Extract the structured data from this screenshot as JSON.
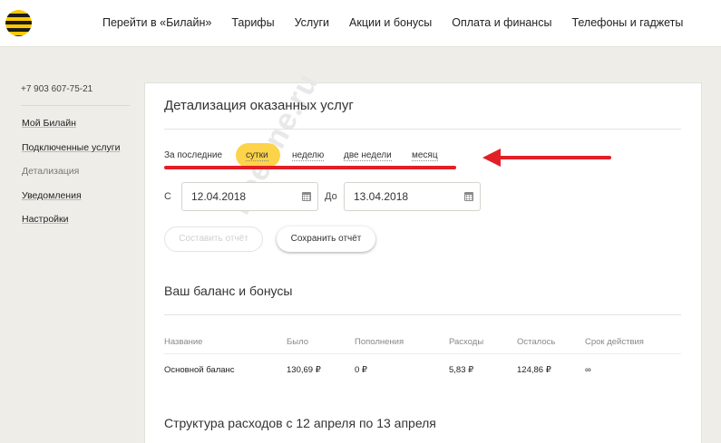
{
  "header": {
    "nav": [
      "Перейти в «Билайн»",
      "Тарифы",
      "Услуги",
      "Акции и бонусы",
      "Оплата и финансы",
      "Телефоны и гаджеты"
    ]
  },
  "sidebar": {
    "phone": "+7 903 607-75-21",
    "items": [
      {
        "label": "Мой Билайн"
      },
      {
        "label": "Подключенные услуги"
      },
      {
        "label": "Детализация"
      },
      {
        "label": "Уведомления"
      },
      {
        "label": "Настройки"
      }
    ]
  },
  "detail": {
    "title": "Детализация оказанных услуг",
    "period_label": "За последние",
    "period_options": [
      "сутки",
      "неделю",
      "две недели",
      "месяц"
    ],
    "selected_period": "сутки",
    "from_label": "С",
    "from_date": "12.04.2018",
    "to_label": "До",
    "to_date": "13.04.2018",
    "build_report": "Составить отчёт",
    "save_report": "Сохранить отчёт"
  },
  "balance": {
    "title": "Ваш баланс и бонусы",
    "columns": [
      "Название",
      "Было",
      "Пополнения",
      "Расходы",
      "Осталось",
      "Срок действия"
    ],
    "rows": [
      [
        "Основной баланс",
        "130,69 ₽",
        "0 ₽",
        "5,83 ₽",
        "124,86 ₽",
        "∞"
      ]
    ]
  },
  "structure": {
    "title": "Структура расходов с 12 апреля по 13 апреля"
  },
  "watermark": "beeline.ru",
  "colors": {
    "brand_yellow": "#fdd34a",
    "annotation_red": "#e21f26",
    "page_bg": "#efede8"
  }
}
